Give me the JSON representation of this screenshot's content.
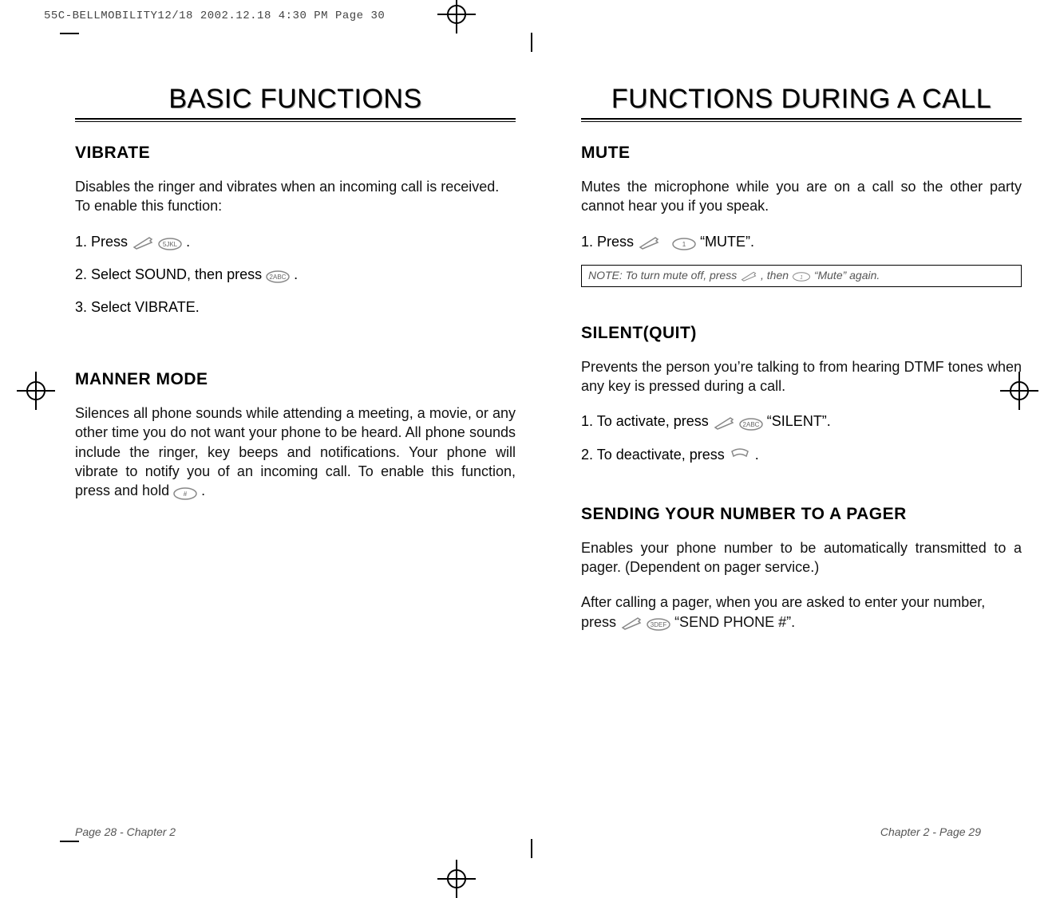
{
  "meta": {
    "top_line": "55C-BELLMOBILITY12/18  2002.12.18  4:30 PM  Page 30"
  },
  "left": {
    "title": "BASIC FUNCTIONS",
    "vibrate": {
      "heading": "VIBRATE",
      "intro": "Disables the ringer and vibrates when an incoming call is received. To enable this function:",
      "step1_a": "1. Press ",
      "step1_b": " .",
      "step2_a": "2. Select SOUND, then press  ",
      "step2_b": "  .",
      "step3": "3. Select VIBRATE."
    },
    "manner": {
      "heading": "MANNER MODE",
      "body_a": "Silences all phone sounds while attending a meeting, a movie, or any other time you do not want your phone to be heard. All phone sounds include the ringer, key beeps and notifications.  Your phone will vibrate to notify you of an incoming call. To enable this function, press and hold ",
      "body_b": " ."
    },
    "folio": "Page 28 - Chapter 2"
  },
  "right": {
    "title": "FUNCTIONS DURING A CALL",
    "mute": {
      "heading": "MUTE",
      "intro": "Mutes the microphone while you are on a call so the other party cannot hear you if you speak.",
      "step1_a": "1. Press ",
      "step1_b": " “MUTE”.",
      "note_a": "NOTE: To turn mute off, press  ",
      "note_b": "  , then ",
      "note_c": "  “Mute” again."
    },
    "silent": {
      "heading": "SILENT(QUIT)",
      "intro": "Prevents the person you’re talking to from hearing DTMF tones when any key is pressed during a call.",
      "step1_a": "1. To activate, press ",
      "step1_b": "  “SILENT”.",
      "step2_a": "2. To deactivate, press  ",
      "step2_b": "  ."
    },
    "pager": {
      "heading": "SENDING YOUR NUMBER TO A PAGER",
      "intro": "Enables your phone number to be automatically transmitted to a pager. (Dependent on pager service.)",
      "body_a": "After calling a pager, when you are asked to enter your number, press ",
      "body_b": " “SEND PHONE #”."
    },
    "folio": "Chapter 2 - Page 29"
  },
  "icons": {
    "soft": "soft-key-icon",
    "k1": "key-1-icon",
    "k2": "key-2-icon",
    "k3": "key-3-icon",
    "k5": "key-5-icon",
    "hash": "key-hash-icon",
    "end": "end-key-icon"
  }
}
